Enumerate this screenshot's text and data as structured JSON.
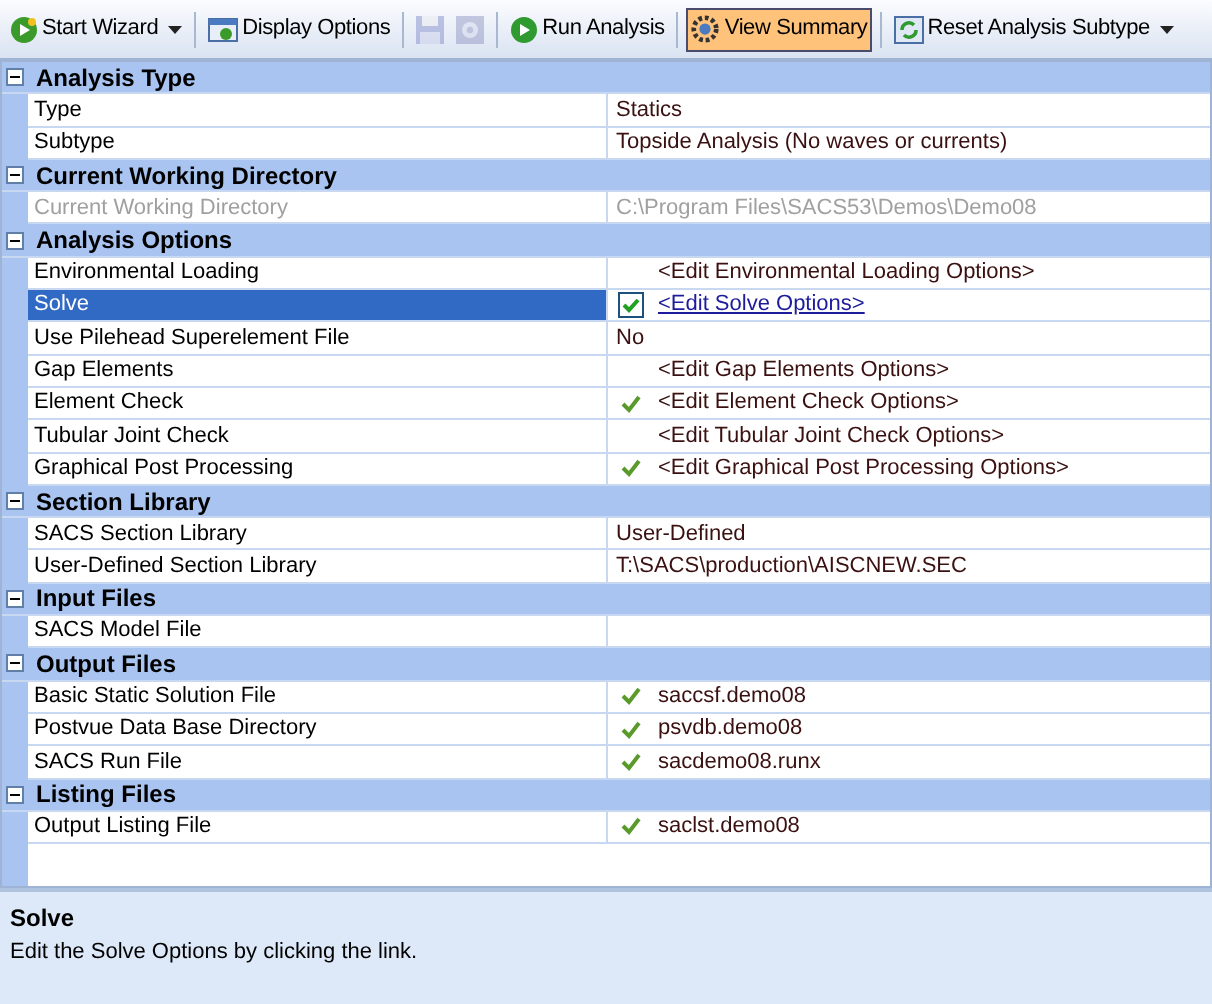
{
  "toolbar": [
    {
      "kind": "button",
      "label": "Start Wizard",
      "dropdown": true,
      "pressed": false
    },
    {
      "kind": "separator"
    },
    {
      "kind": "button",
      "label": "Display Options",
      "dropdown": false,
      "pressed": false
    },
    {
      "kind": "separator"
    },
    {
      "kind": "icon",
      "disabled": true
    },
    {
      "kind": "icon",
      "disabled": true
    },
    {
      "kind": "separator"
    },
    {
      "kind": "button",
      "label": "Run Analysis",
      "dropdown": false,
      "pressed": false
    },
    {
      "kind": "separator"
    },
    {
      "kind": "button",
      "label": "View Summary",
      "dropdown": false,
      "pressed": true
    },
    {
      "kind": "separator"
    },
    {
      "kind": "button",
      "label": "Reset Analysis Subtype",
      "dropdown": true,
      "pressed": false
    }
  ],
  "grid": {
    "categories": [
      {
        "title": "Analysis Type",
        "expanded": true,
        "rows": [
          {
            "kind": "text",
            "label": "Type",
            "value": "Statics",
            "selected": false,
            "disabled": false
          },
          {
            "kind": "text",
            "label": "Subtype",
            "value": "Topside Analysis (No waves or currents)",
            "selected": false,
            "disabled": false
          }
        ]
      },
      {
        "title": "Current Working Directory",
        "expanded": true,
        "rows": [
          {
            "kind": "text",
            "label": "Current Working Directory",
            "value": "C:\\Program Files\\SACS53\\Demos\\Demo08",
            "selected": false,
            "disabled": true
          }
        ]
      },
      {
        "title": "Analysis Options",
        "expanded": true,
        "rows": [
          {
            "kind": "link",
            "label": "Environmental Loading",
            "value": "<Edit Environmental Loading Options>",
            "checked": false,
            "selected": false,
            "disabled": false
          },
          {
            "kind": "link",
            "label": "Solve",
            "value": "<Edit Solve Options>",
            "checked": true,
            "selected": true,
            "disabled": false
          },
          {
            "kind": "text",
            "label": "Use Pilehead Superelement File",
            "value": "No",
            "selected": false,
            "disabled": false
          },
          {
            "kind": "link",
            "label": "Gap Elements",
            "value": "<Edit Gap Elements Options>",
            "checked": false,
            "selected": false,
            "disabled": false
          },
          {
            "kind": "link",
            "label": "Element Check",
            "value": "<Edit Element Check Options>",
            "checked": true,
            "selected": false,
            "disabled": false
          },
          {
            "kind": "link",
            "label": "Tubular Joint Check",
            "value": "<Edit Tubular Joint Check Options>",
            "checked": false,
            "selected": false,
            "disabled": false
          },
          {
            "kind": "link",
            "label": "Graphical Post Processing",
            "value": "<Edit Graphical Post Processing Options>",
            "checked": true,
            "selected": false,
            "disabled": false
          }
        ]
      },
      {
        "title": "Section Library",
        "expanded": true,
        "rows": [
          {
            "kind": "text",
            "label": "SACS Section Library",
            "value": "User-Defined",
            "selected": false,
            "disabled": false
          },
          {
            "kind": "text",
            "label": "User-Defined Section Library",
            "value": "T:\\SACS\\production\\AISCNEW.SEC",
            "selected": false,
            "disabled": false
          }
        ]
      },
      {
        "title": "Input Files",
        "expanded": true,
        "rows": [
          {
            "kind": "empty",
            "label": "SACS Model File",
            "selected": false,
            "disabled": false
          }
        ]
      },
      {
        "title": "Output Files",
        "expanded": true,
        "rows": [
          {
            "kind": "link",
            "label": "Basic Static Solution File",
            "value": "saccsf.demo08",
            "checked": true,
            "selected": false,
            "disabled": false
          },
          {
            "kind": "link",
            "label": "Postvue Data Base Directory",
            "value": "psvdb.demo08",
            "checked": true,
            "selected": false,
            "disabled": false
          },
          {
            "kind": "link",
            "label": "SACS Run File",
            "value": "sacdemo08.runx",
            "checked": true,
            "selected": false,
            "disabled": false
          }
        ]
      },
      {
        "title": "Listing Files",
        "expanded": true,
        "rows": [
          {
            "kind": "link",
            "label": "Output Listing File",
            "value": "saclst.demo08",
            "checked": true,
            "selected": false,
            "disabled": false
          }
        ]
      }
    ]
  },
  "description": {
    "title": "Solve",
    "text": "Edit the Solve Options by clicking the link."
  }
}
